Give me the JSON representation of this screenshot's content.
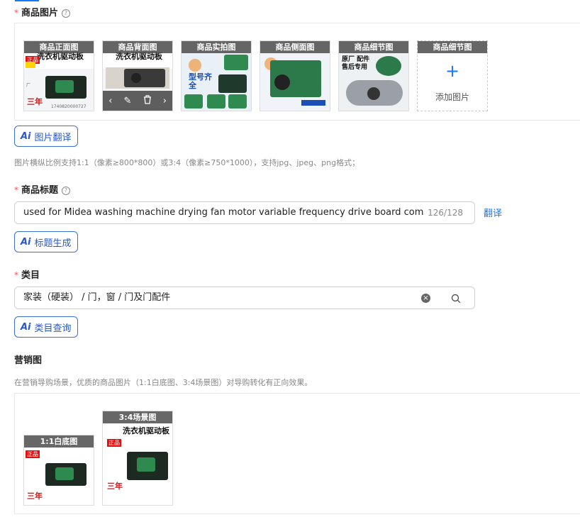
{
  "product_images": {
    "label": "商品图片",
    "required_mark": "*",
    "help": "?",
    "items": [
      {
        "caption": "商品正面图",
        "banner": "洗衣机驱动板",
        "badge": "正品",
        "footer": "三年"
      },
      {
        "caption": "商品背面图",
        "banner": "洗衣机驱动板"
      },
      {
        "caption": "商品实拍图",
        "badge": "型号齐全"
      },
      {
        "caption": "商品侧面图"
      },
      {
        "caption": "商品细节图",
        "badge": "原厂 配件 售后专用"
      }
    ],
    "hover_actions": {
      "prev": "‹",
      "edit": "✎",
      "delete": "🗑",
      "next": "›"
    },
    "add_slot": {
      "caption": "商品细节图",
      "plus": "+",
      "label": "添加图片"
    },
    "translate_button": {
      "ai": "Ai",
      "label": "图片翻译"
    },
    "hint": "图片横纵比例支持1:1（像素≥800*800）或3:4（像素≥750*1000），支持jpg、jpeg、png格式；"
  },
  "product_title": {
    "label": "商品标题",
    "required_mark": "*",
    "help": "?",
    "value": "used for Midea washing machine drying fan motor variable frequency drive board compute",
    "count": "126/128",
    "translate_link": "翻译",
    "generate_button": {
      "ai": "Ai",
      "label": "标题生成"
    }
  },
  "category": {
    "label": "类目",
    "required_mark": "*",
    "value": "家装（硬装） / 门，窗 / 门及门配件",
    "clear": "×",
    "query_button": {
      "ai": "Ai",
      "label": "类目查询"
    }
  },
  "marketing": {
    "label": "营销图",
    "hint": "在营销导购场景，优质的商品图片（1:1白底图、3:4场景图）对导购转化有正向效果。",
    "items": [
      {
        "caption": "1:1白底图",
        "badge": "正品",
        "footer": "三年"
      },
      {
        "caption": "3:4场景图",
        "banner": "洗衣机驱动板",
        "badge": "正品",
        "footer": "三年"
      }
    ]
  },
  "colors": {
    "accent": "#1677ff",
    "required": "#ff4d4f",
    "ai_blue": "#2a57c8",
    "badge_red": "#e10f0f"
  }
}
